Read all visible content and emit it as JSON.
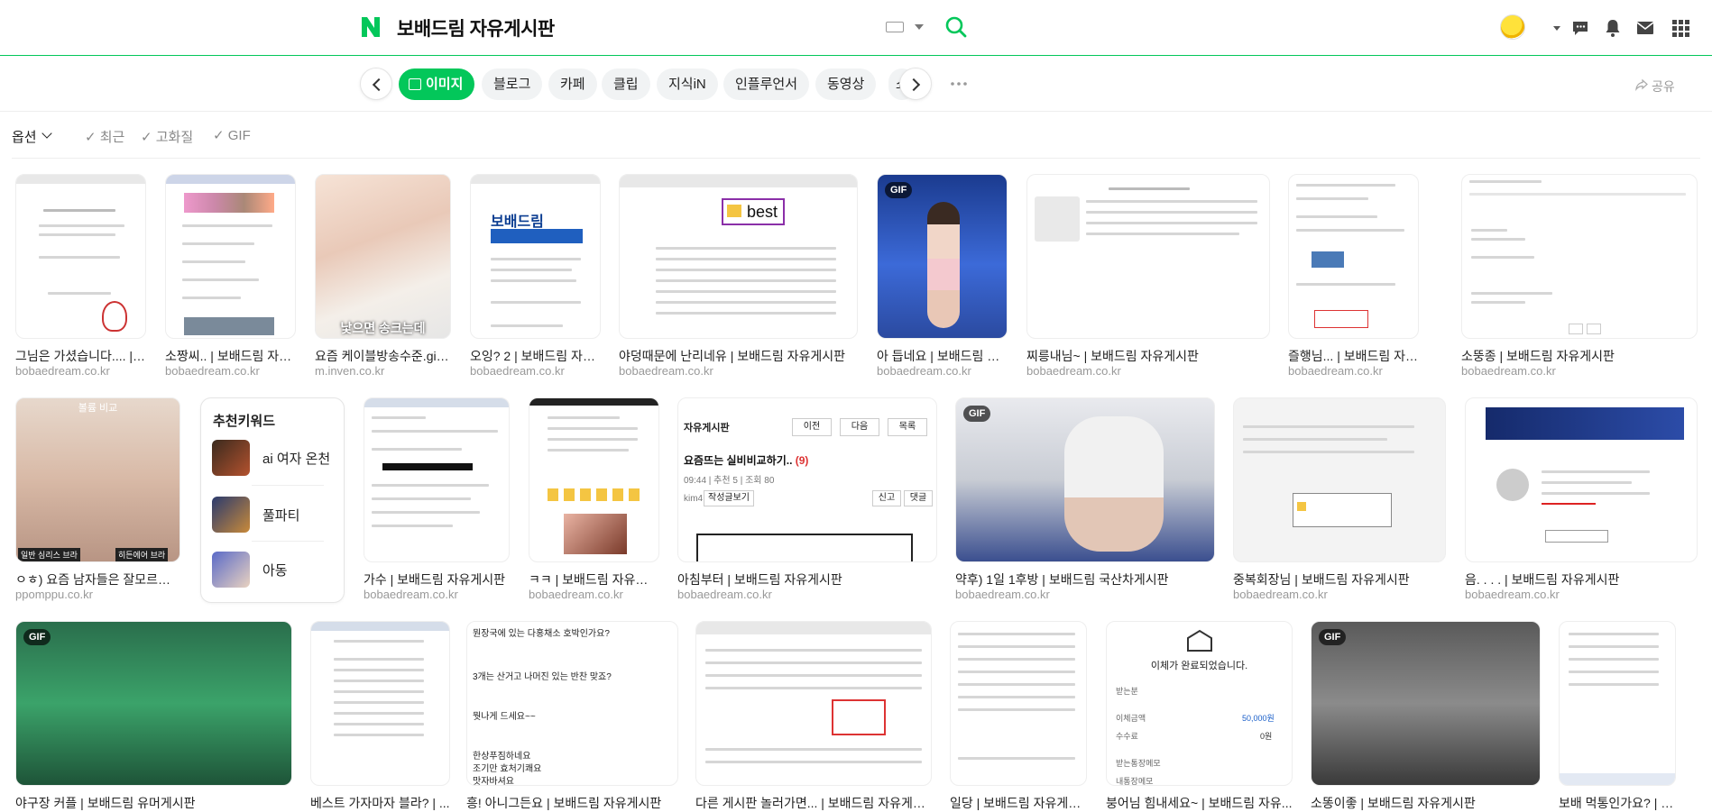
{
  "header": {
    "logo": "N",
    "query": "보배드림 자유게시판",
    "icons": [
      "keyboard-icon",
      "search-icon",
      "chat-icon",
      "bell-icon",
      "mail-icon",
      "apps-icon"
    ]
  },
  "tabs": {
    "items": [
      {
        "label": "이미지",
        "active": true
      },
      {
        "label": "블로그"
      },
      {
        "label": "카페"
      },
      {
        "label": "클립"
      },
      {
        "label": "지식iN"
      },
      {
        "label": "인플루언서"
      },
      {
        "label": "동영상"
      },
      {
        "label": "쇼"
      }
    ],
    "share_label": "공유"
  },
  "options": {
    "label": "옵션",
    "filters": [
      "최근",
      "고화질",
      "GIF"
    ]
  },
  "results": [
    {
      "title": "그님은 가셨습니다.... | ...",
      "source": "bobaedream.co.kr"
    },
    {
      "title": "소짱씨.. | 보배드림 자유...",
      "source": "bobaedream.co.kr"
    },
    {
      "title": "요즘 케이블방송수준.gif ...",
      "source": "m.inven.co.kr",
      "caption": "낯으면 송크는데"
    },
    {
      "title": "오잉? 2 | 보배드림 자유...",
      "source": "bobaedream.co.kr",
      "caption": "보배드림"
    },
    {
      "title": "야덩때문에 난리네유 | 보배드림 자유게시판",
      "source": "bobaedream.co.kr",
      "caption": "best"
    },
    {
      "title": "아 듭네요 | 보배드림 자...",
      "source": "bobaedream.co.kr",
      "badge": "GIF"
    },
    {
      "title": "찌릉내님~ | 보배드림 자유게시판",
      "source": "bobaedream.co.kr"
    },
    {
      "title": "즐행님... | 보배드림 자유게...",
      "source": "bobaedream.co.kr"
    },
    {
      "title": "소뚱종 | 보배드림 자유게시판",
      "source": "bobaedream.co.kr"
    },
    {
      "title": "ㅇㅎ) 요즘 남자들은 잘모르는 ...",
      "source": "ppomppu.co.kr",
      "caption": "볼륨 비교",
      "sub_left": "일반 심리스 브라",
      "sub_right": "히든에어 브라"
    },
    {
      "title": "가수 | 보배드림 자유게시판",
      "source": "bobaedream.co.kr"
    },
    {
      "title": "ㅋㅋ | 보배드림 자유게시판",
      "source": "bobaedream.co.kr"
    },
    {
      "title": "아침부터 | 보배드림 자유게시판",
      "source": "bobaedream.co.kr",
      "caption": "자유게시판",
      "post": "요즘뜨는 실비비교하기..",
      "count": "(9)",
      "meta": "09:44 | 추천 5 | 조회 80",
      "btns": [
        "이전",
        "다음",
        "목록"
      ],
      "writer": "kim4",
      "write_btn": "작성글보기",
      "report": "신고",
      "reply": "댓글"
    },
    {
      "title": "약후) 1일 1후방 | 보배드림 국산차게시판",
      "source": "bobaedream.co.kr",
      "badge": "GIF"
    },
    {
      "title": "중복회장님 | 보배드림 자유게시판",
      "source": "bobaedream.co.kr"
    },
    {
      "title": "음. . . . | 보배드림 자유게시판",
      "source": "bobaedream.co.kr"
    },
    {
      "title": "야구장 커플 | 보배드림 유머게시판",
      "source": "",
      "badge": "GIF"
    },
    {
      "title": "베스트 가자마자 블라? | ...",
      "source": ""
    },
    {
      "title": "흥! 아니그든요 | 보배드림 자유게시판",
      "source": "",
      "caption": "뭔장국에 있는 다홍채소 호박인가요?",
      "post": "3개는 산거고 나머진 있는 반찬 맞죠?",
      "line2": "뭣나게 드세요~~",
      "line3": "한상푸짐하네요",
      "line4": "조기만 효처기쾌요",
      "line5": "맛자바셔요"
    },
    {
      "title": "다른 게시판 놀러가면... | 보배드림 자유게시판",
      "source": ""
    },
    {
      "title": "일당 | 보배드림 자유게시...",
      "source": ""
    },
    {
      "title": "붕어님 힘내세요~ | 보배드림 자유...",
      "source": "",
      "caption": "이체가 완료되었습니다.",
      "row1": "받는분",
      "row2": "이체금액",
      "val2": "50,000원",
      "row3": "수수료",
      "val3": "0원",
      "row4": "받는통장메모",
      "row5": "내통장메모"
    },
    {
      "title": "소똥이좋 | 보배드림 자유게시판",
      "source": "",
      "badge": "GIF"
    },
    {
      "title": "보배 먹통인가요? | 보배드...",
      "source": ""
    }
  ],
  "keywords": {
    "title": "추천키워드",
    "items": [
      {
        "label": "ai 여자 온천"
      },
      {
        "label": "풀파티"
      },
      {
        "label": "아동"
      }
    ]
  },
  "colors": {
    "brand": "#03c75a",
    "text": "#222222",
    "muted": "#999999"
  }
}
